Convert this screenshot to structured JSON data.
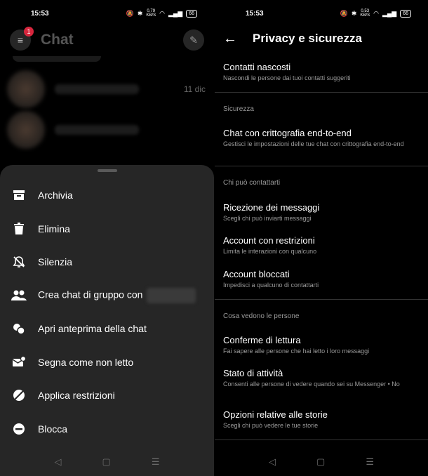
{
  "left": {
    "status": {
      "time": "15:53",
      "speed_top": "0.79",
      "speed_unit": "KB/S",
      "battery": "66"
    },
    "header": {
      "title": "Chat",
      "badge_count": "1"
    },
    "chat_list": {
      "date": "11 dic"
    },
    "sheet": {
      "options": [
        {
          "label": "Archivia",
          "icon": "archive-icon"
        },
        {
          "label": "Elimina",
          "icon": "trash-icon"
        },
        {
          "label": "Silenzia",
          "icon": "bell-off-icon"
        },
        {
          "label": "Crea chat di gruppo con",
          "icon": "people-icon"
        },
        {
          "label": "Apri anteprima della chat",
          "icon": "chat-preview-icon"
        },
        {
          "label": "Segna come non letto",
          "icon": "mail-unread-icon"
        },
        {
          "label": "Applica restrizioni",
          "icon": "restrict-icon"
        },
        {
          "label": "Blocca",
          "icon": "block-icon"
        }
      ]
    }
  },
  "right": {
    "status": {
      "time": "15:53",
      "speed_top": "0.53",
      "speed_unit": "KB/S",
      "battery": "66"
    },
    "header": {
      "title": "Privacy e sicurezza"
    },
    "items": [
      {
        "title": "Contatti nascosti",
        "subtitle": "Nascondi le persone dai tuoi contatti suggeriti"
      },
      {
        "section": "Sicurezza"
      },
      {
        "title": "Chat con crittografia end-to-end",
        "subtitle": "Gestisci le impostazioni delle tue chat con crittografia end-to-end"
      },
      {
        "section": "Chi può contattarti"
      },
      {
        "title": "Ricezione dei messaggi",
        "subtitle": "Scegli chi può inviarti messaggi"
      },
      {
        "title": "Account con restrizioni",
        "subtitle": "Limita le interazioni con qualcuno"
      },
      {
        "title": "Account bloccati",
        "subtitle": "Impedisci a qualcuno di contattarti"
      },
      {
        "section": "Cosa vedono le persone"
      },
      {
        "title": "Conferme di lettura",
        "subtitle": "Fai sapere alle persone che hai letto i loro messaggi"
      },
      {
        "title": "Stato di attività",
        "subtitle": "Consenti alle persone di vedere quando sei su Messenger • No"
      },
      {
        "title": "Opzioni relative alle storie",
        "subtitle": "Scegli chi può vedere le tue storie"
      }
    ]
  }
}
